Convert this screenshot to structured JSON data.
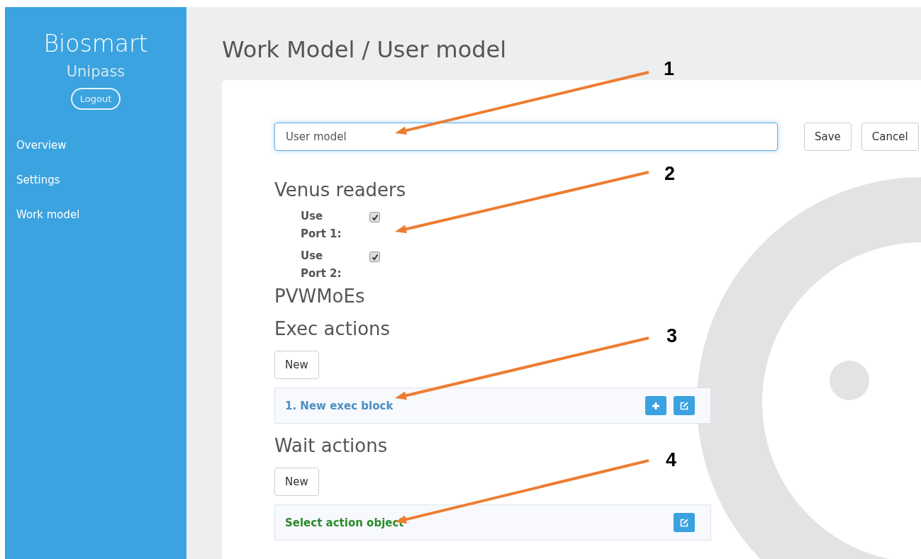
{
  "sidebar": {
    "brand": "Biosmart",
    "subtitle": "Unipass",
    "logout": "Logout",
    "items": [
      {
        "label": "Overview"
      },
      {
        "label": "Settings"
      },
      {
        "label": "Work model"
      }
    ]
  },
  "page_title": "Work Model / User model",
  "name_field": {
    "value": "User model"
  },
  "buttons": [
    "Save",
    "Cancel"
  ],
  "venus_readers": {
    "title": "Venus readers",
    "ports": [
      {
        "label": "Use Port 1:",
        "checked": true
      },
      {
        "label": "Use Port 2:",
        "checked": true
      }
    ]
  },
  "pvwmoes": {
    "title": "PVWMoEs"
  },
  "exec_actions": {
    "title": "Exec actions",
    "new_button": "New",
    "blocks": [
      {
        "label": "1. New exec block",
        "kind": "exec"
      }
    ]
  },
  "wait_actions": {
    "title": "Wait actions",
    "new_button": "New",
    "blocks": [
      {
        "label": "Select action object",
        "kind": "wait"
      }
    ]
  },
  "callouts": [
    {
      "number": "1"
    },
    {
      "number": "2"
    },
    {
      "number": "3"
    },
    {
      "number": "4"
    }
  ]
}
